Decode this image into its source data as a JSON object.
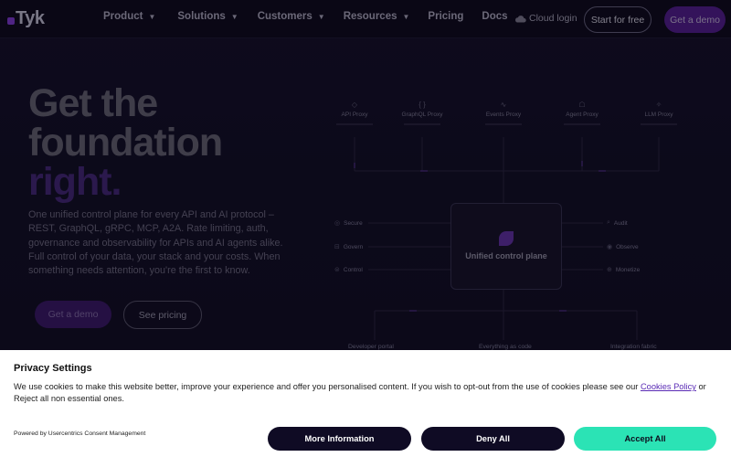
{
  "nav": {
    "logo_text": "Tyk",
    "menu": [
      {
        "label": "Product",
        "has_caret": true
      },
      {
        "label": "Solutions",
        "has_caret": true
      },
      {
        "label": "Customers",
        "has_caret": true
      },
      {
        "label": "Resources",
        "has_caret": true
      },
      {
        "label": "Pricing",
        "has_caret": false
      },
      {
        "label": "Docs",
        "has_caret": false
      }
    ],
    "cloud_login": "Cloud login",
    "start_free": "Start for free",
    "get_demo": "Get a demo"
  },
  "hero": {
    "title_line1": "Get the",
    "title_line2": "foundation",
    "title_line3": "right.",
    "description": "One unified control plane for every API and AI protocol – REST, GraphQL, gRPC, MCP, A2A. Rate limiting, auth, governance and observability for APIs and AI agents alike. Full control of your data, your stack and your costs. When something needs attention, you're the first to know.",
    "cta_demo": "Get a demo",
    "cta_pricing": "See pricing"
  },
  "diagram": {
    "proxies": [
      {
        "label": "API Proxy",
        "icon": "api-icon"
      },
      {
        "label": "GraphQL Proxy",
        "icon": "graphql-icon"
      },
      {
        "label": "Events Proxy",
        "icon": "events-icon"
      },
      {
        "label": "Agent Proxy",
        "icon": "agent-icon"
      },
      {
        "label": "LLM Proxy",
        "icon": "llm-icon"
      }
    ],
    "left_items": [
      "Secure",
      "Govern",
      "Control"
    ],
    "right_items": [
      "Audit",
      "Observe",
      "Monetize"
    ],
    "core_label": "Unified control plane",
    "bottom_items": [
      "Developer portal",
      "Everything as code",
      "Integration fabric"
    ]
  },
  "cookie": {
    "title": "Privacy Settings",
    "text_before": "We use cookies to make this website better, improve your experience and offer you personalised content. If you wish to opt-out from the use of cookies please see our ",
    "link": "Cookies Policy",
    "text_after": " or Reject all non essential ones.",
    "powered_by": "Powered by Usercentrics Consent Management",
    "more_info": "More Information",
    "deny_all": "Deny All",
    "accept_all": "Accept All"
  },
  "colors": {
    "brand_purple": "#5a1f9c",
    "accept_green": "#2be3b5",
    "dark_button": "#0f0b24"
  }
}
